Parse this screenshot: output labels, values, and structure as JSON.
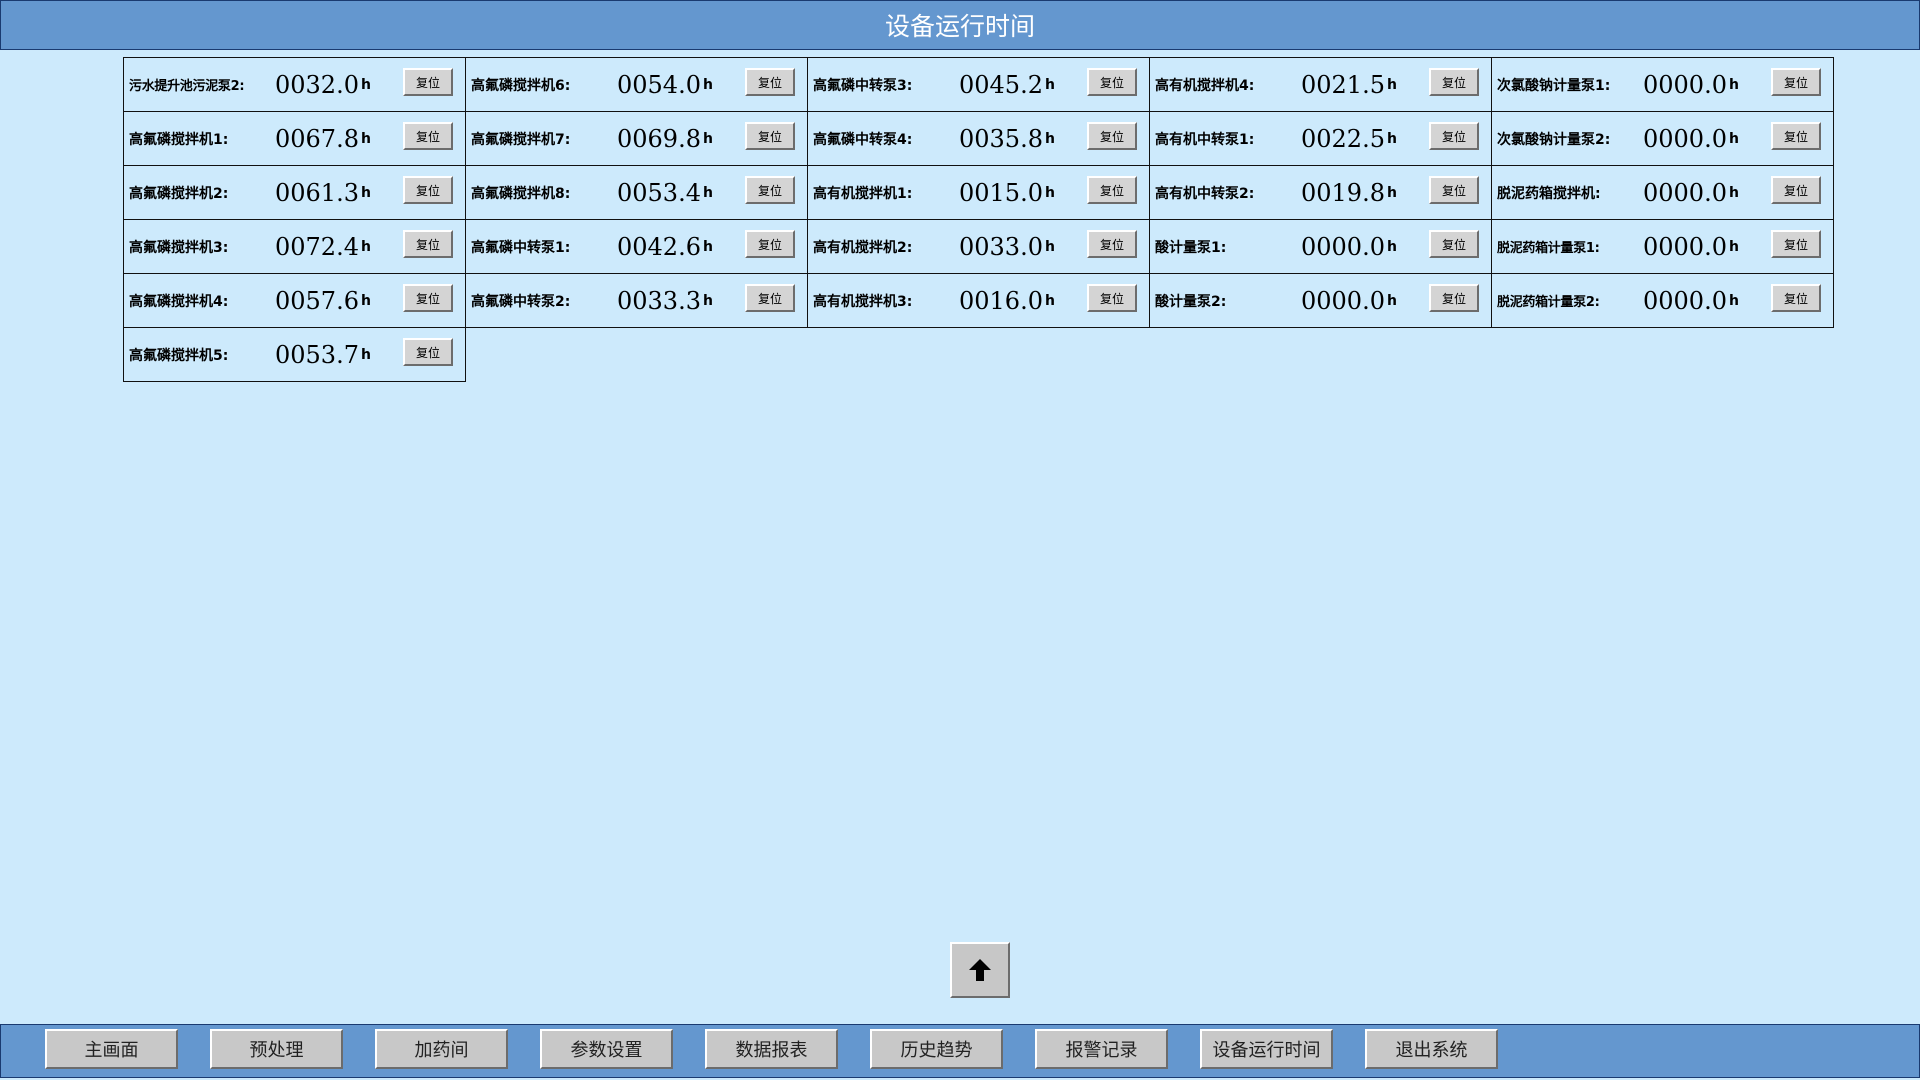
{
  "header": {
    "title": "设备运行时间"
  },
  "reset_label": "复位",
  "unit": "h",
  "columns": [
    [
      {
        "label": "污水提升池污泥泵2:",
        "value": "0032.0",
        "small": true
      },
      {
        "label": "高氟磷搅拌机1:",
        "value": "0067.8"
      },
      {
        "label": "高氟磷搅拌机2:",
        "value": "0061.3"
      },
      {
        "label": "高氟磷搅拌机3:",
        "value": "0072.4"
      },
      {
        "label": "高氟磷搅拌机4:",
        "value": "0057.6"
      },
      {
        "label": "高氟磷搅拌机5:",
        "value": "0053.7"
      }
    ],
    [
      {
        "label": "高氟磷搅拌机6:",
        "value": "0054.0"
      },
      {
        "label": "高氟磷搅拌机7:",
        "value": "0069.8"
      },
      {
        "label": "高氟磷搅拌机8:",
        "value": "0053.4"
      },
      {
        "label": "高氟磷中转泵1:",
        "value": "0042.6"
      },
      {
        "label": "高氟磷中转泵2:",
        "value": "0033.3"
      }
    ],
    [
      {
        "label": "高氟磷中转泵3:",
        "value": "0045.2"
      },
      {
        "label": "高氟磷中转泵4:",
        "value": "0035.8"
      },
      {
        "label": "高有机搅拌机1:",
        "value": "0015.0"
      },
      {
        "label": "高有机搅拌机2:",
        "value": "0033.0"
      },
      {
        "label": "高有机搅拌机3:",
        "value": "0016.0"
      }
    ],
    [
      {
        "label": "高有机搅拌机4:",
        "value": "0021.5"
      },
      {
        "label": "高有机中转泵1:",
        "value": "0022.5"
      },
      {
        "label": "高有机中转泵2:",
        "value": "0019.8"
      },
      {
        "label": "酸计量泵1:",
        "value": "0000.0"
      },
      {
        "label": "酸计量泵2:",
        "value": "0000.0"
      }
    ],
    [
      {
        "label": "次氯酸钠计量泵1:",
        "value": "0000.0"
      },
      {
        "label": "次氯酸钠计量泵2:",
        "value": "0000.0"
      },
      {
        "label": "脱泥药箱搅拌机:",
        "value": "0000.0"
      },
      {
        "label": "脱泥药箱计量泵1:",
        "value": "0000.0",
        "small": true
      },
      {
        "label": "脱泥药箱计量泵2:",
        "value": "0000.0",
        "small": true
      }
    ]
  ],
  "up_button": {
    "icon": "arrow-up-icon"
  },
  "nav": [
    {
      "label": "主画面"
    },
    {
      "label": "预处理"
    },
    {
      "label": "加药间"
    },
    {
      "label": "参数设置"
    },
    {
      "label": "数据报表"
    },
    {
      "label": "历史趋势"
    },
    {
      "label": "报警记录"
    },
    {
      "label": "设备运行时间"
    },
    {
      "label": "退出系统"
    }
  ]
}
